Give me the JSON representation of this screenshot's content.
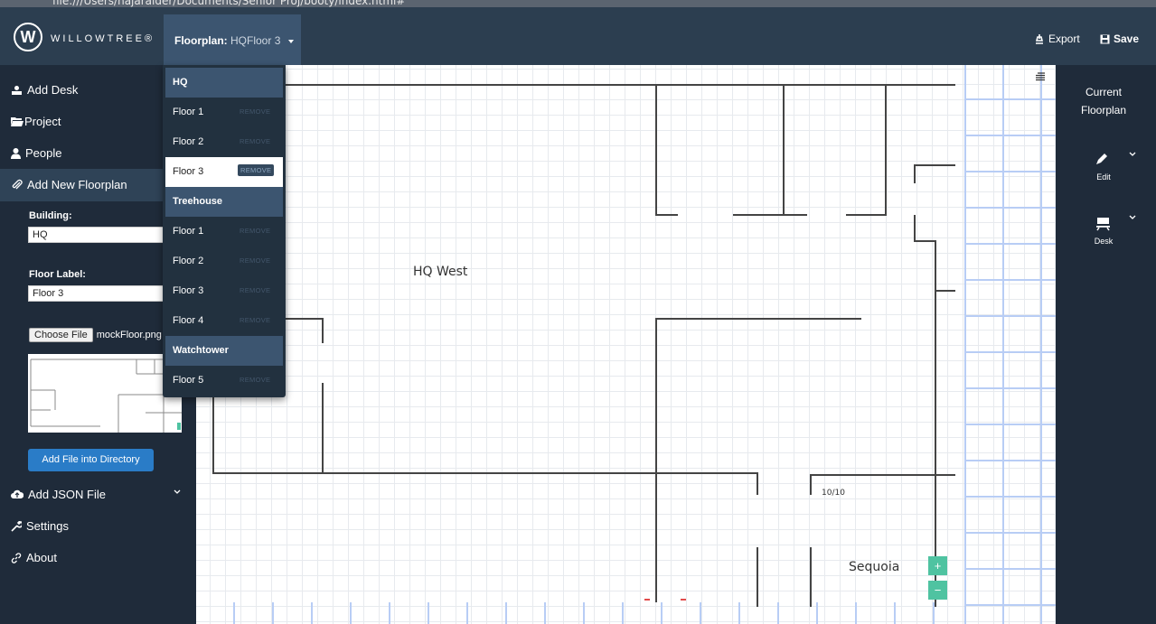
{
  "browser": {
    "url": "file:///Users/hajaraider/Documents/Senior Proj/booty/index.html#"
  },
  "brand": {
    "name": "WILLOWTREE®",
    "logo_letter": "W"
  },
  "header": {
    "floorplan_label": "Floorplan:",
    "floorplan_value": "HQFloor 3",
    "export_label": "Export",
    "save_label": "Save"
  },
  "sidebar": {
    "add_desk": "Add Desk",
    "project": "Project",
    "people": "People",
    "add_new_floorplan": "Add New Floorplan",
    "building_label": "Building:",
    "building_value": "HQ",
    "floor_label_label": "Floor Label:",
    "floor_label_value": "Floor 3",
    "choose_file_button": "Choose File",
    "chosen_file": "mockFloor.png",
    "add_file_button": "Add File into Directory",
    "add_json_file": "Add JSON File",
    "settings": "Settings",
    "about": "About"
  },
  "dropdown": {
    "remove_label": "REMOVE",
    "groups": [
      {
        "name": "HQ",
        "floors": [
          "Floor 1",
          "Floor 2",
          "Floor 3"
        ]
      },
      {
        "name": "Treehouse",
        "floors": [
          "Floor 1",
          "Floor 2",
          "Floor 3",
          "Floor 4"
        ]
      },
      {
        "name": "Watchtower",
        "floors": [
          "Floor 5"
        ]
      }
    ],
    "selected": "HQ / Floor 3"
  },
  "canvas": {
    "room_hq_west": "HQ West",
    "room_sequoia": "Sequoia",
    "desk_count": "10/10",
    "zoom_in": "+",
    "zoom_out": "−"
  },
  "rightbar": {
    "title": "Current Floorplan",
    "edit_label": "Edit",
    "desk_label": "Desk"
  },
  "colors": {
    "nav_bg": "#2c3e50",
    "sidebar_bg": "#1f2b3a",
    "accent_blue": "#2a7cc7",
    "zoom_green": "#4fc3a1"
  }
}
